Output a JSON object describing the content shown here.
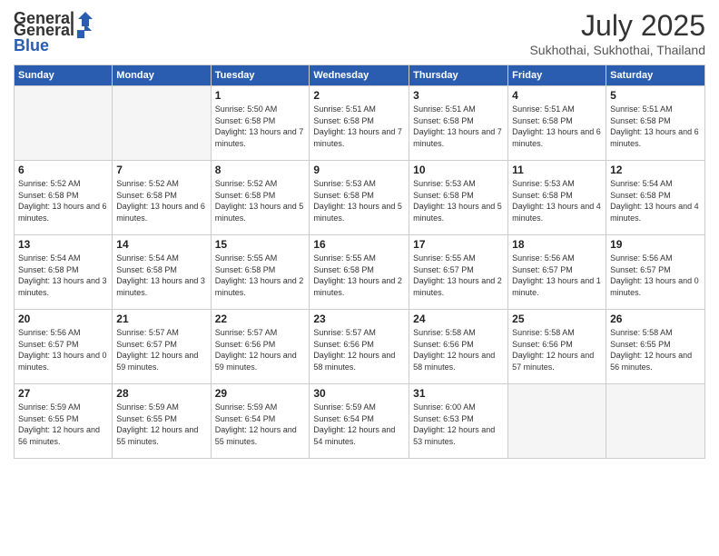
{
  "header": {
    "logo_general": "General",
    "logo_blue": "Blue",
    "title": "July 2025",
    "location": "Sukhothai, Sukhothai, Thailand"
  },
  "days_of_week": [
    "Sunday",
    "Monday",
    "Tuesday",
    "Wednesday",
    "Thursday",
    "Friday",
    "Saturday"
  ],
  "weeks": [
    [
      {
        "day": "",
        "empty": true
      },
      {
        "day": "",
        "empty": true
      },
      {
        "day": "1",
        "sunrise": "5:50 AM",
        "sunset": "6:58 PM",
        "daylight": "13 hours and 7 minutes."
      },
      {
        "day": "2",
        "sunrise": "5:51 AM",
        "sunset": "6:58 PM",
        "daylight": "13 hours and 7 minutes."
      },
      {
        "day": "3",
        "sunrise": "5:51 AM",
        "sunset": "6:58 PM",
        "daylight": "13 hours and 7 minutes."
      },
      {
        "day": "4",
        "sunrise": "5:51 AM",
        "sunset": "6:58 PM",
        "daylight": "13 hours and 6 minutes."
      },
      {
        "day": "5",
        "sunrise": "5:51 AM",
        "sunset": "6:58 PM",
        "daylight": "13 hours and 6 minutes."
      }
    ],
    [
      {
        "day": "6",
        "sunrise": "5:52 AM",
        "sunset": "6:58 PM",
        "daylight": "13 hours and 6 minutes."
      },
      {
        "day": "7",
        "sunrise": "5:52 AM",
        "sunset": "6:58 PM",
        "daylight": "13 hours and 6 minutes."
      },
      {
        "day": "8",
        "sunrise": "5:52 AM",
        "sunset": "6:58 PM",
        "daylight": "13 hours and 5 minutes."
      },
      {
        "day": "9",
        "sunrise": "5:53 AM",
        "sunset": "6:58 PM",
        "daylight": "13 hours and 5 minutes."
      },
      {
        "day": "10",
        "sunrise": "5:53 AM",
        "sunset": "6:58 PM",
        "daylight": "13 hours and 5 minutes."
      },
      {
        "day": "11",
        "sunrise": "5:53 AM",
        "sunset": "6:58 PM",
        "daylight": "13 hours and 4 minutes."
      },
      {
        "day": "12",
        "sunrise": "5:54 AM",
        "sunset": "6:58 PM",
        "daylight": "13 hours and 4 minutes."
      }
    ],
    [
      {
        "day": "13",
        "sunrise": "5:54 AM",
        "sunset": "6:58 PM",
        "daylight": "13 hours and 3 minutes."
      },
      {
        "day": "14",
        "sunrise": "5:54 AM",
        "sunset": "6:58 PM",
        "daylight": "13 hours and 3 minutes."
      },
      {
        "day": "15",
        "sunrise": "5:55 AM",
        "sunset": "6:58 PM",
        "daylight": "13 hours and 2 minutes."
      },
      {
        "day": "16",
        "sunrise": "5:55 AM",
        "sunset": "6:58 PM",
        "daylight": "13 hours and 2 minutes."
      },
      {
        "day": "17",
        "sunrise": "5:55 AM",
        "sunset": "6:57 PM",
        "daylight": "13 hours and 2 minutes."
      },
      {
        "day": "18",
        "sunrise": "5:56 AM",
        "sunset": "6:57 PM",
        "daylight": "13 hours and 1 minute."
      },
      {
        "day": "19",
        "sunrise": "5:56 AM",
        "sunset": "6:57 PM",
        "daylight": "13 hours and 0 minutes."
      }
    ],
    [
      {
        "day": "20",
        "sunrise": "5:56 AM",
        "sunset": "6:57 PM",
        "daylight": "13 hours and 0 minutes."
      },
      {
        "day": "21",
        "sunrise": "5:57 AM",
        "sunset": "6:57 PM",
        "daylight": "12 hours and 59 minutes."
      },
      {
        "day": "22",
        "sunrise": "5:57 AM",
        "sunset": "6:56 PM",
        "daylight": "12 hours and 59 minutes."
      },
      {
        "day": "23",
        "sunrise": "5:57 AM",
        "sunset": "6:56 PM",
        "daylight": "12 hours and 58 minutes."
      },
      {
        "day": "24",
        "sunrise": "5:58 AM",
        "sunset": "6:56 PM",
        "daylight": "12 hours and 58 minutes."
      },
      {
        "day": "25",
        "sunrise": "5:58 AM",
        "sunset": "6:56 PM",
        "daylight": "12 hours and 57 minutes."
      },
      {
        "day": "26",
        "sunrise": "5:58 AM",
        "sunset": "6:55 PM",
        "daylight": "12 hours and 56 minutes."
      }
    ],
    [
      {
        "day": "27",
        "sunrise": "5:59 AM",
        "sunset": "6:55 PM",
        "daylight": "12 hours and 56 minutes."
      },
      {
        "day": "28",
        "sunrise": "5:59 AM",
        "sunset": "6:55 PM",
        "daylight": "12 hours and 55 minutes."
      },
      {
        "day": "29",
        "sunrise": "5:59 AM",
        "sunset": "6:54 PM",
        "daylight": "12 hours and 55 minutes."
      },
      {
        "day": "30",
        "sunrise": "5:59 AM",
        "sunset": "6:54 PM",
        "daylight": "12 hours and 54 minutes."
      },
      {
        "day": "31",
        "sunrise": "6:00 AM",
        "sunset": "6:53 PM",
        "daylight": "12 hours and 53 minutes."
      },
      {
        "day": "",
        "empty": true
      },
      {
        "day": "",
        "empty": true
      }
    ]
  ]
}
